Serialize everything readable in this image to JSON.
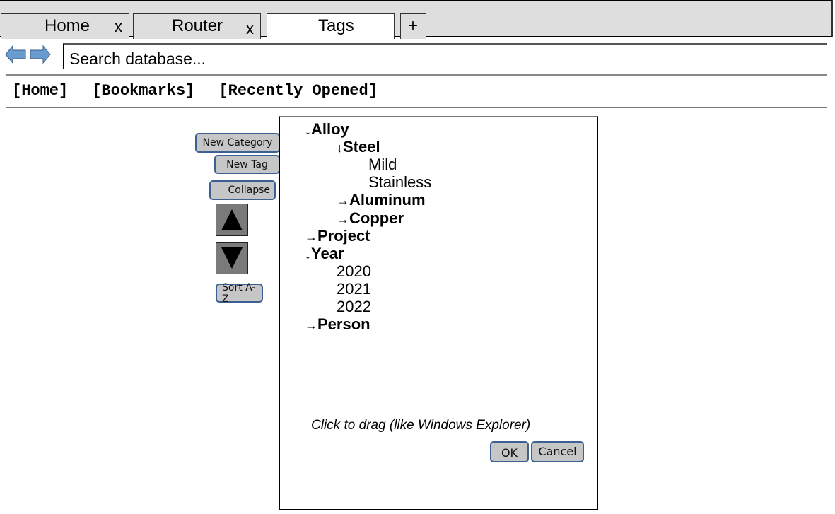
{
  "tabs": [
    {
      "label": "Home",
      "close": "x",
      "active": false
    },
    {
      "label": "Router",
      "close": "x",
      "active": false
    },
    {
      "label": "Tags",
      "close": "",
      "active": true
    }
  ],
  "new_tab_label": "+",
  "nav": {
    "back_icon": "back-arrow-icon",
    "forward_icon": "forward-arrow-icon",
    "arrow_color": "#6a9bd0"
  },
  "search": {
    "placeholder": "Search database...",
    "value": ""
  },
  "bookmarks": [
    "[Home]",
    "[Bookmarks]",
    "[Recently Opened]"
  ],
  "side_buttons": {
    "new_category": "New Category",
    "new_tag": "New Tag",
    "collapse": "Collapse",
    "move_up_icon": "triangle-up-icon",
    "move_down_icon": "triangle-down-icon",
    "sort": "Sort A-Z"
  },
  "tree": [
    {
      "label": "Alloy",
      "level": 0,
      "type": "category",
      "expanded": true,
      "arrow": "↓"
    },
    {
      "label": "Steel",
      "level": 1,
      "type": "category",
      "expanded": true,
      "arrow": "↓"
    },
    {
      "label": "Mild",
      "level": 2,
      "type": "tag"
    },
    {
      "label": "Stainless",
      "level": 2,
      "type": "tag"
    },
    {
      "label": "Aluminum",
      "level": 1,
      "type": "category",
      "expanded": false,
      "arrow": "→"
    },
    {
      "label": "Copper",
      "level": 1,
      "type": "category",
      "expanded": false,
      "arrow": "→"
    },
    {
      "label": "Project",
      "level": 0,
      "type": "category",
      "expanded": false,
      "arrow": "→"
    },
    {
      "label": "Year",
      "level": 0,
      "type": "category",
      "expanded": true,
      "arrow": "↓"
    },
    {
      "label": "2020",
      "level": 1,
      "type": "tag"
    },
    {
      "label": "2021",
      "level": 1,
      "type": "tag"
    },
    {
      "label": "2022",
      "level": 1,
      "type": "tag"
    },
    {
      "label": "Person",
      "level": 0,
      "type": "category",
      "expanded": false,
      "arrow": "→"
    }
  ],
  "hint": "Click to drag (like Windows Explorer)",
  "dialog": {
    "ok": "OK",
    "cancel": "Cancel"
  },
  "colors": {
    "button_border": "#3c5f94",
    "button_fill": "#c6c6c6",
    "tabbar_bg": "#dedede"
  }
}
